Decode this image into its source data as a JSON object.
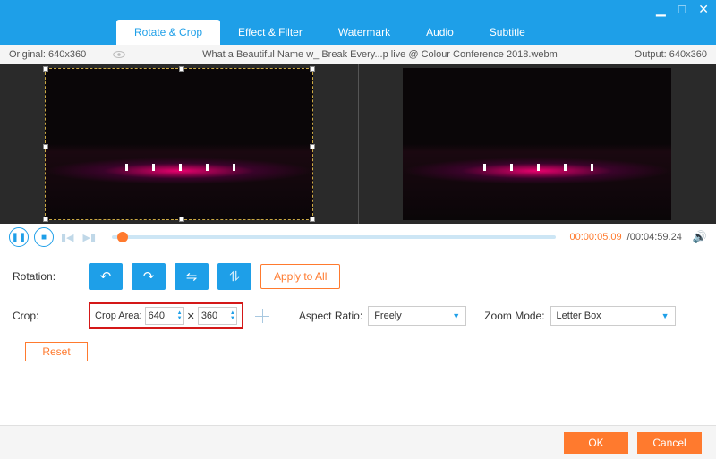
{
  "window": {
    "minimize": "▁",
    "maximize": "□",
    "close": "✕"
  },
  "tabs": [
    "Rotate & Crop",
    "Effect & Filter",
    "Watermark",
    "Audio",
    "Subtitle"
  ],
  "active_tab": 0,
  "info": {
    "original_label": "Original: 640x360",
    "filename": "What a Beautiful Name w_ Break Every...p live @ Colour Conference 2018.webm",
    "output_label": "Output: 640x360"
  },
  "playback": {
    "time_current": "00:00:05.09",
    "time_total": "/00:04:59.24"
  },
  "rotation": {
    "label": "Rotation:",
    "apply_all": "Apply to All"
  },
  "crop": {
    "label": "Crop:",
    "area_label": "Crop Area:",
    "width": "640",
    "sep": "✕",
    "height": "360",
    "aspect_label": "Aspect Ratio:",
    "aspect_value": "Freely",
    "zoom_label": "Zoom Mode:",
    "zoom_value": "Letter Box",
    "reset": "Reset"
  },
  "footer": {
    "ok": "OK",
    "cancel": "Cancel"
  }
}
